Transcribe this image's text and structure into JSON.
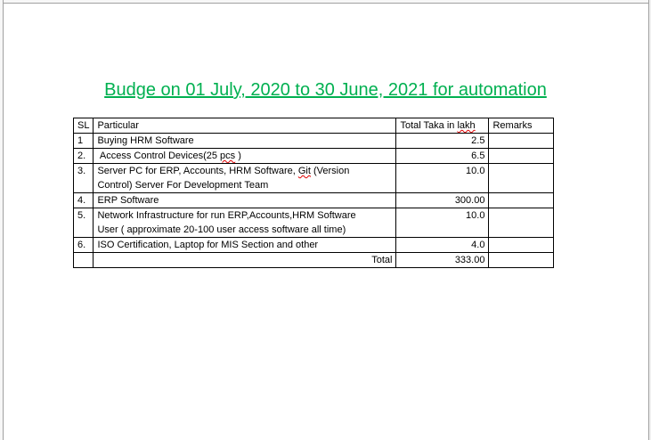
{
  "document": {
    "title": "Budge on 01 July, 2020 to 30 June, 2021 for automation",
    "title_color": "#00b050"
  },
  "table": {
    "headers": {
      "sl": "SL",
      "particular": "Particular",
      "total": "Total Taka in lakh",
      "remarks": "Remarks"
    },
    "rows": [
      {
        "sl": "1",
        "particular_lines": [
          "Buying HRM Software"
        ],
        "total": "2.5",
        "remarks": ""
      },
      {
        "sl": "2.",
        "particular_lines": [
          " Access Control Devices(25 pcs )"
        ],
        "total": "6.5",
        "remarks": ""
      },
      {
        "sl": "3.",
        "particular_lines": [
          "Server PC for ERP, Accounts, HRM Software, Git (Version",
          "Control) Server For Development Team"
        ],
        "total": "10.0",
        "remarks": ""
      },
      {
        "sl": "4.",
        "particular_lines": [
          "ERP Software"
        ],
        "total": "300.00",
        "remarks": ""
      },
      {
        "sl": "5.",
        "particular_lines": [
          "Network Infrastructure for run ERP,Accounts,HRM Software",
          "User ( approximate 20-100 user access software all time)"
        ],
        "total": "10.0",
        "remarks": ""
      },
      {
        "sl": "6.",
        "particular_lines": [
          "ISO Certification, Laptop for MIS Section and other"
        ],
        "total": "4.0",
        "remarks": ""
      }
    ],
    "total_row": {
      "label": "Total",
      "value": "333.00"
    }
  }
}
